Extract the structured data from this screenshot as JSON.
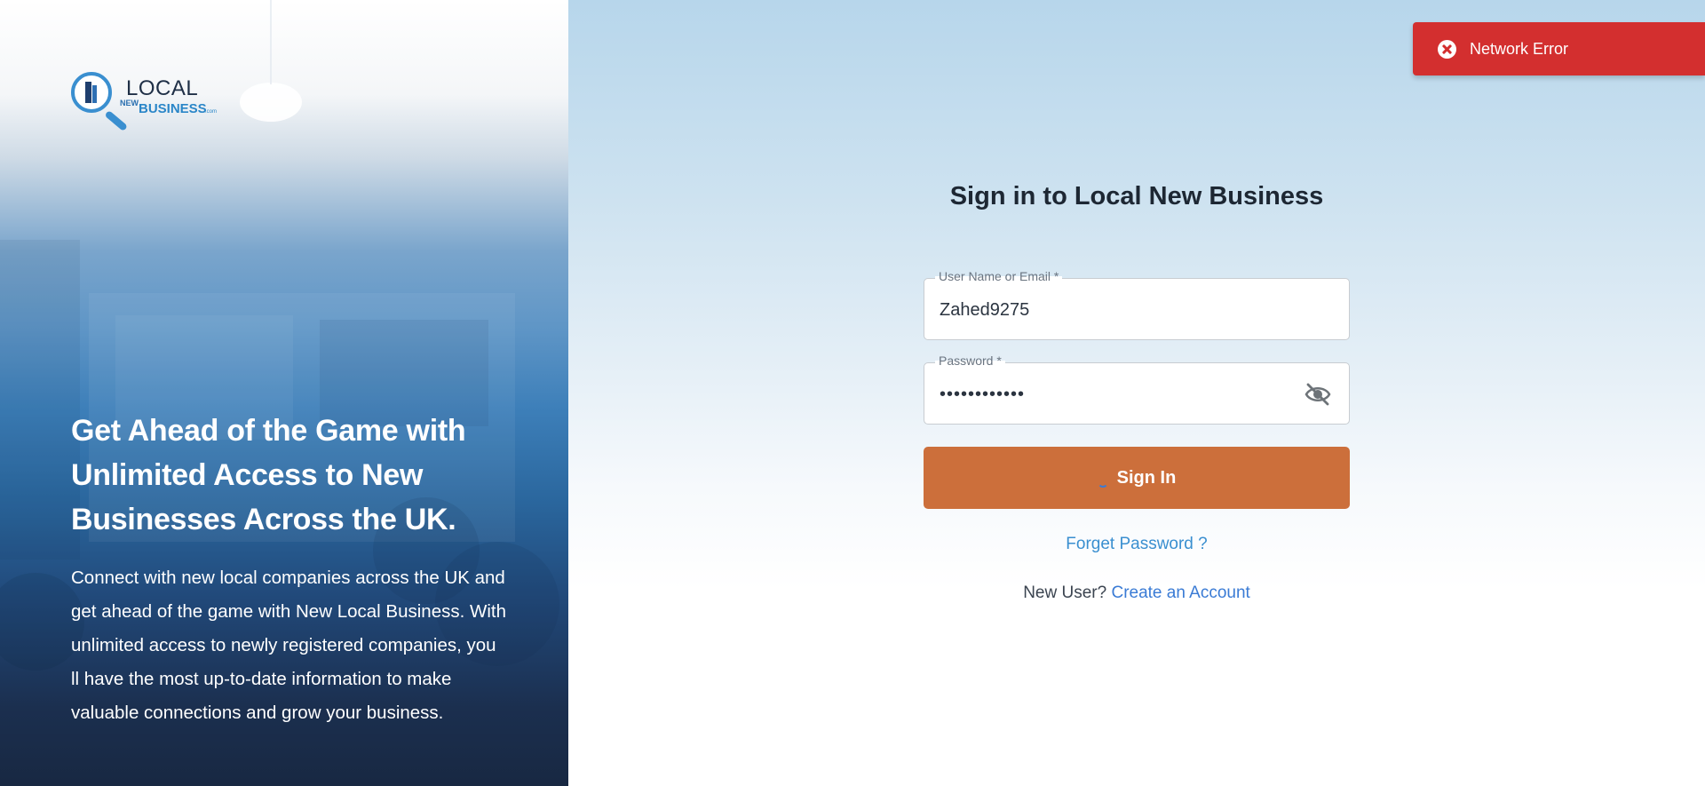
{
  "brand": {
    "logo_local": "LOCAL",
    "logo_new": "NEW",
    "logo_business": "BUSINESS",
    "logo_com": ".com"
  },
  "hero": {
    "title": "Get Ahead of the Game with Unlimited Access to New Businesses Across the UK.",
    "description": "Connect with new local companies across the UK and get ahead of the game with New Local Business. With unlimited access to newly registered companies, you ll have the most up-to-date information to make valuable connections and grow your business."
  },
  "toast": {
    "message": "Network Error",
    "icon": "close-circle-icon",
    "color": "#d32f2f"
  },
  "form": {
    "title": "Sign in to Local New Business",
    "username_label": "User Name or Email *",
    "username_value": "Zahed9275",
    "password_label": "Password *",
    "password_value": "••••••••••••",
    "password_toggle_icon": "eye-off-icon",
    "submit_label": "Sign In",
    "submit_color": "#cc6f3b",
    "forgot_label": "Forget Password ?",
    "new_user_prompt": "New User?",
    "create_account_label": "Create an Account"
  }
}
